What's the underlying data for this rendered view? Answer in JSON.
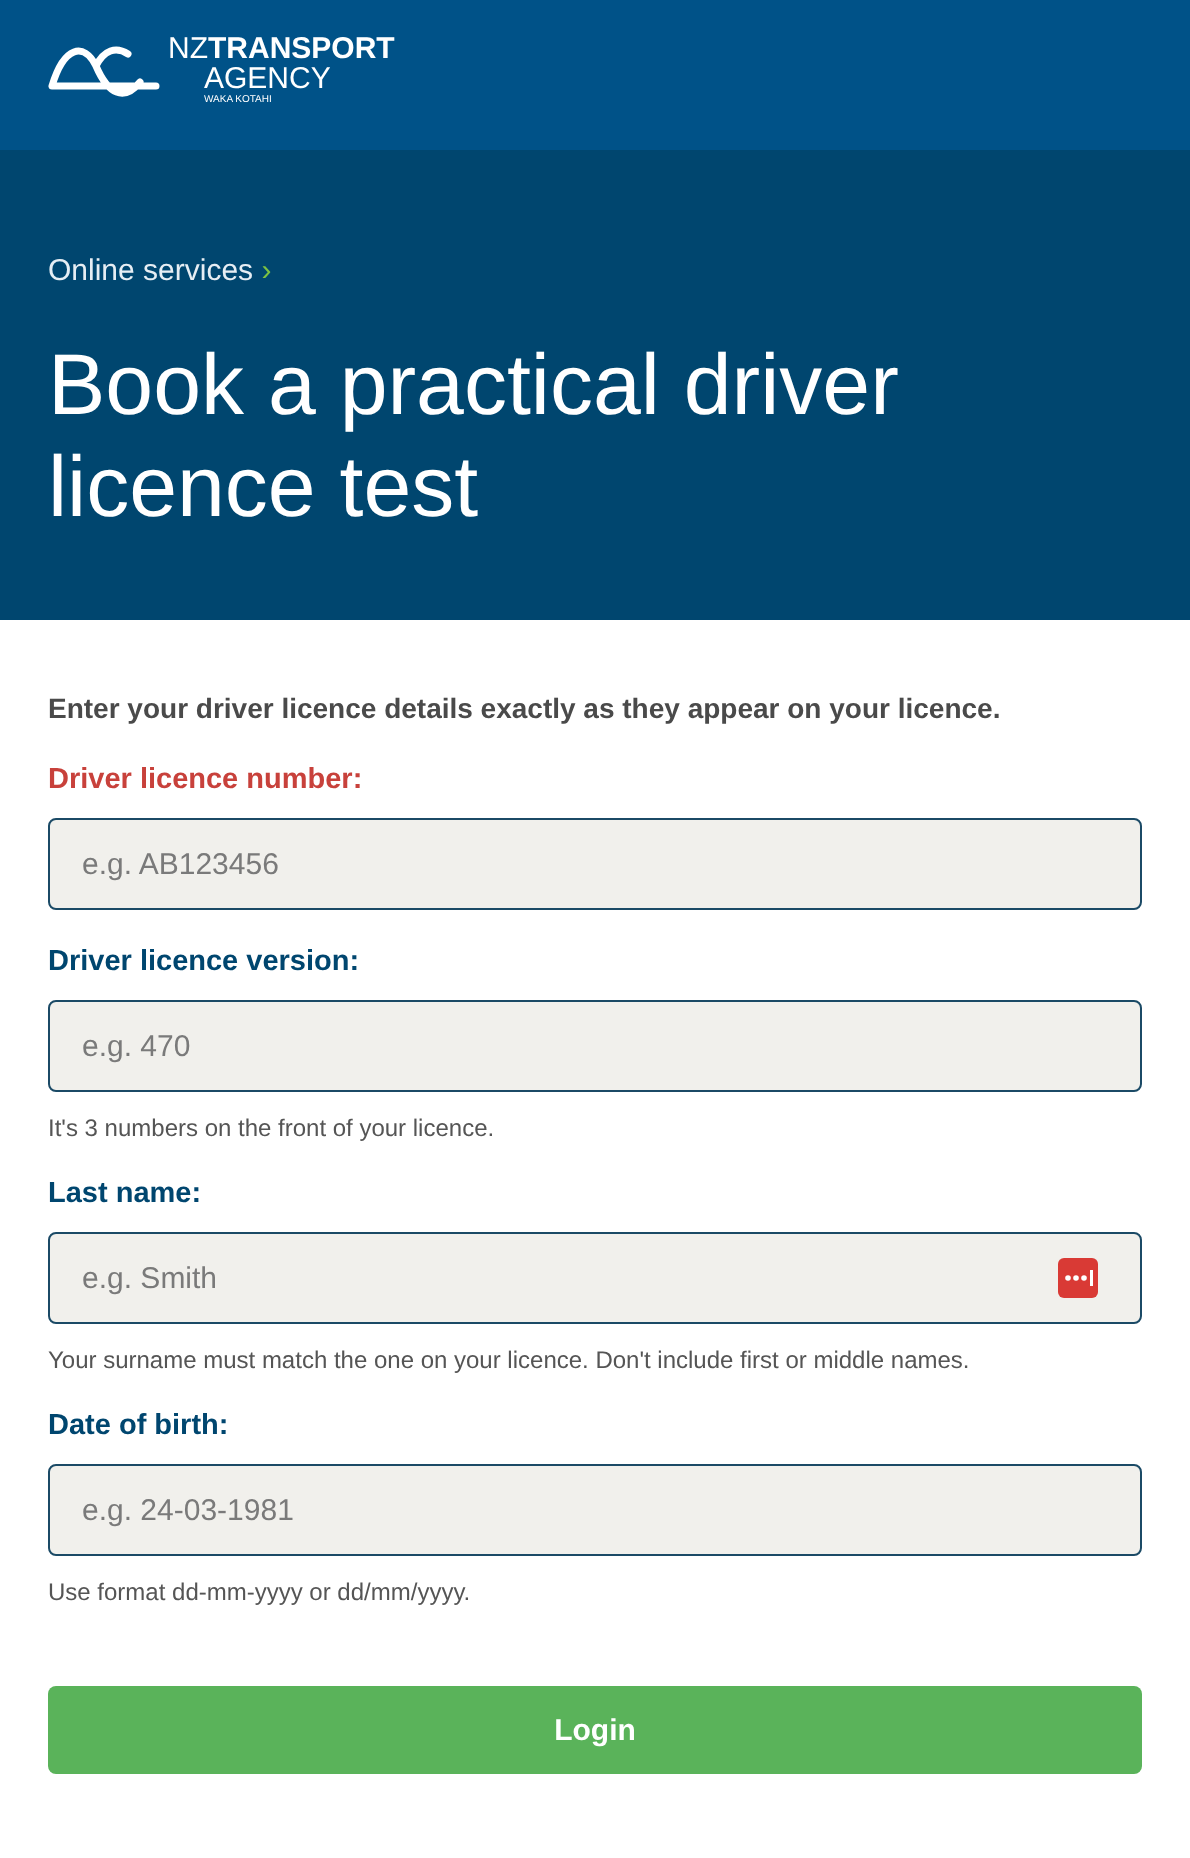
{
  "logo": {
    "prefix": "NZ",
    "name": "TRANSPORT",
    "line2": "AGENCY",
    "line3": "WAKA KOTAHI"
  },
  "breadcrumb": {
    "label": "Online services",
    "separator": "›"
  },
  "title": "Book a practical driver licence test",
  "intro": "Enter your driver licence details exactly as they appear on your licence.",
  "fields": [
    {
      "label": "Driver licence number:",
      "placeholder": "e.g. AB123456",
      "invalid": true,
      "autofill_icon": false
    },
    {
      "label": "Driver licence version:",
      "placeholder": "e.g. 470",
      "hint": "It's 3 numbers on the front of your licence.",
      "invalid": false,
      "autofill_icon": false
    },
    {
      "label": "Last name:",
      "placeholder": "e.g. Smith",
      "hint": "Your surname must match the one on your licence. Don't include first or middle names.",
      "invalid": false,
      "autofill_icon": true
    },
    {
      "label": "Date of birth:",
      "placeholder": "e.g. 24-03-1981",
      "hint": "Use format dd-mm-yyyy or dd/mm/yyyy.",
      "invalid": false,
      "autofill_icon": false
    }
  ],
  "button": "Login"
}
